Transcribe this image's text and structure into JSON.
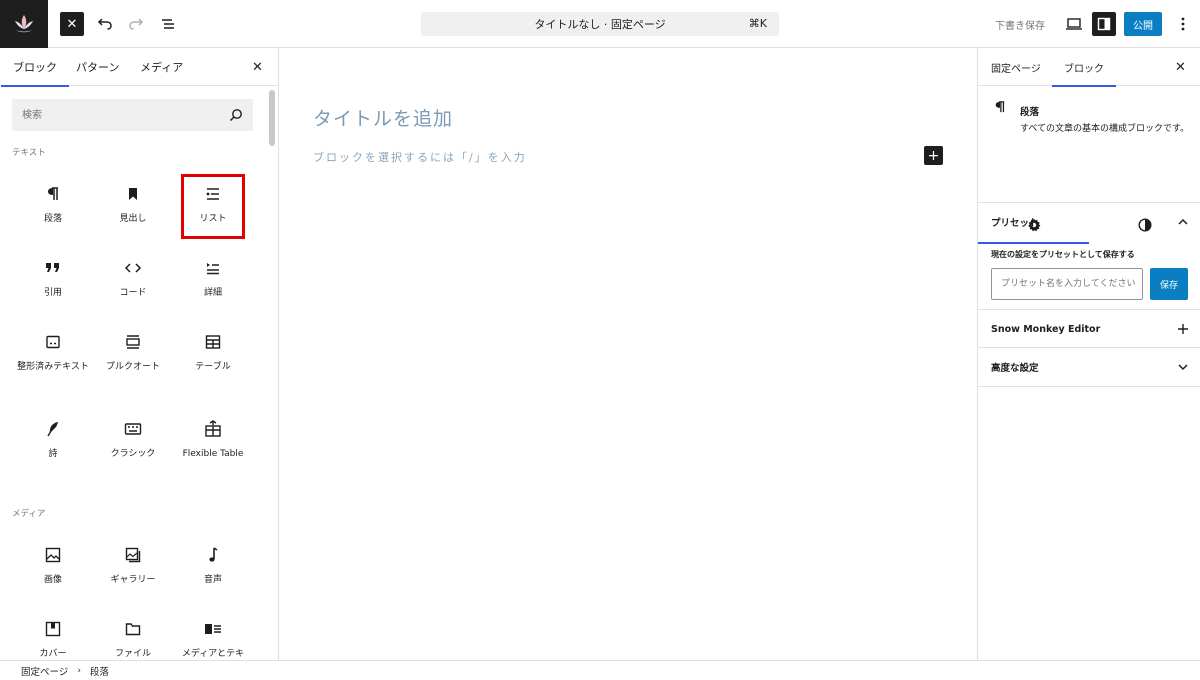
{
  "topbar": {
    "command_bar": "タイトルなし · 固定ページ",
    "shortcut": "⌘K",
    "draft_label": "下書き保存",
    "publish_label": "公開"
  },
  "inserter": {
    "tabs": [
      "ブロック",
      "パターン",
      "メディア"
    ],
    "search_placeholder": "検索",
    "categories": {
      "text": "テキスト",
      "media": "メディア"
    },
    "text_blocks": [
      {
        "label": "段落",
        "icon": "paragraph-icon"
      },
      {
        "label": "見出し",
        "icon": "heading-icon"
      },
      {
        "label": "リスト",
        "icon": "list-icon"
      },
      {
        "label": "引用",
        "icon": "quote-icon"
      },
      {
        "label": "コード",
        "icon": "code-icon"
      },
      {
        "label": "詳細",
        "icon": "details-icon"
      },
      {
        "label": "整形済みテキスト",
        "icon": "preformatted-icon"
      },
      {
        "label": "プルクオート",
        "icon": "pullquote-icon"
      },
      {
        "label": "テーブル",
        "icon": "table-icon"
      },
      {
        "label": "詩",
        "icon": "verse-icon"
      },
      {
        "label": "クラシック",
        "icon": "classic-icon"
      },
      {
        "label": "Flexible Table",
        "icon": "flexible-table-icon"
      }
    ],
    "media_blocks": [
      {
        "label": "画像",
        "icon": "image-icon"
      },
      {
        "label": "ギャラリー",
        "icon": "gallery-icon"
      },
      {
        "label": "音声",
        "icon": "audio-icon"
      },
      {
        "label": "カバー",
        "icon": "cover-icon"
      },
      {
        "label": "ファイル",
        "icon": "file-icon"
      },
      {
        "label": "メディアとテキ",
        "icon": "media-text-icon"
      }
    ],
    "highlight_color": "#e40000"
  },
  "canvas": {
    "title_placeholder": "タイトルを追加",
    "paragraph_placeholder": "ブロックを選択するには「/」を入力"
  },
  "settings": {
    "tabs": [
      "固定ページ",
      "ブロック"
    ],
    "block_name": "段落",
    "block_description": "すべての文章の基本の構成ブロックです。",
    "preset_panel": {
      "title": "プリセット",
      "label": "現在の設定をプリセットとして保存する",
      "placeholder": "プリセット名を入力してください",
      "save_label": "保存"
    },
    "snow_monkey_title": "Snow Monkey Editor",
    "advanced_title": "高度な設定"
  },
  "footer": {
    "breadcrumbs": [
      "固定ページ",
      "段落"
    ]
  },
  "colors": {
    "accent": "#3858e9",
    "primary_button": "#0a7ec2"
  }
}
